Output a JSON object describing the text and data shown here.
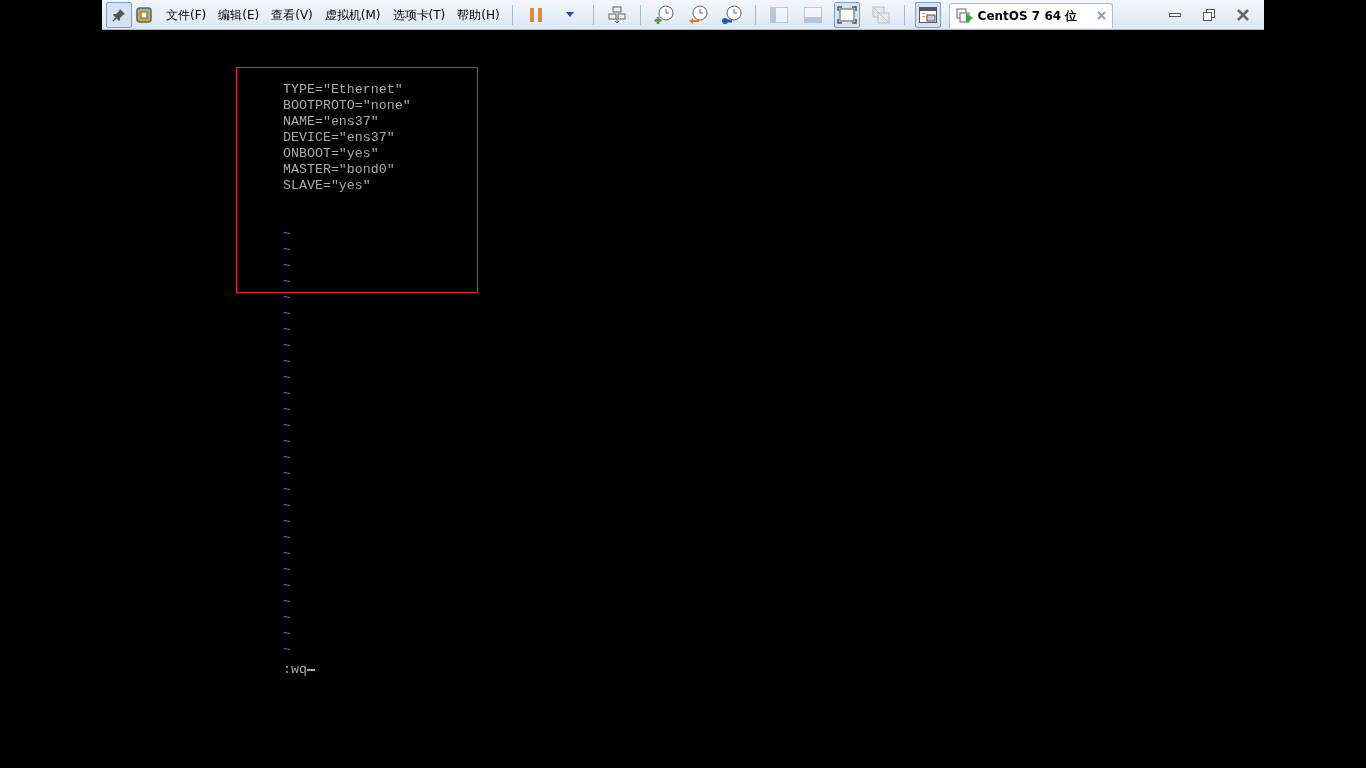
{
  "toolbar": {
    "menus": [
      "文件(F)",
      "编辑(E)",
      "查看(V)",
      "虚拟机(M)",
      "选项卡(T)",
      "帮助(H)"
    ],
    "buttons": [
      {
        "kind": "pause",
        "disabled": false,
        "pressed": false
      },
      {
        "kind": "dropdown",
        "disabled": false,
        "pressed": false
      },
      {
        "kind": "sep"
      },
      {
        "kind": "network",
        "disabled": false,
        "pressed": false
      },
      {
        "kind": "sep"
      },
      {
        "kind": "snapshot-take",
        "disabled": false,
        "pressed": false
      },
      {
        "kind": "snapshot-revert",
        "disabled": false,
        "pressed": false
      },
      {
        "kind": "snapshot-manage",
        "disabled": false,
        "pressed": false
      },
      {
        "kind": "sep"
      },
      {
        "kind": "view-sidebar",
        "disabled": true,
        "pressed": false
      },
      {
        "kind": "view-bottom",
        "disabled": true,
        "pressed": false
      },
      {
        "kind": "fullscreen",
        "disabled": false,
        "pressed": true
      },
      {
        "kind": "unity",
        "disabled": true,
        "pressed": false
      },
      {
        "kind": "sep"
      },
      {
        "kind": "library",
        "disabled": false,
        "pressed": true
      }
    ],
    "pin_pressed": true,
    "tab": {
      "title": "CentOS 7 64 位",
      "selected": true
    }
  },
  "terminal": {
    "lines": [
      {
        "kind": "text",
        "text": "TYPE=\"Ethernet\""
      },
      {
        "kind": "text",
        "text": "BOOTPROTO=\"none\""
      },
      {
        "kind": "text",
        "text": "NAME=\"ens37\""
      },
      {
        "kind": "text",
        "text": "DEVICE=\"ens37\""
      },
      {
        "kind": "text",
        "text": "ONBOOT=\"yes\""
      },
      {
        "kind": "text",
        "text": "MASTER=\"bond0\""
      },
      {
        "kind": "text",
        "text": "SLAVE=\"yes\""
      },
      {
        "kind": "blank"
      },
      {
        "kind": "blank"
      },
      {
        "kind": "tilde",
        "text": "~"
      },
      {
        "kind": "tilde",
        "text": "~"
      },
      {
        "kind": "tilde",
        "text": "~"
      },
      {
        "kind": "tilde",
        "text": "~"
      },
      {
        "kind": "tilde",
        "text": "~"
      },
      {
        "kind": "tilde",
        "text": "~"
      },
      {
        "kind": "tilde",
        "text": "~"
      },
      {
        "kind": "tilde",
        "text": "~"
      },
      {
        "kind": "tilde",
        "text": "~"
      },
      {
        "kind": "tilde",
        "text": "~"
      },
      {
        "kind": "tilde",
        "text": "~"
      },
      {
        "kind": "tilde",
        "text": "~"
      },
      {
        "kind": "tilde",
        "text": "~"
      },
      {
        "kind": "tilde",
        "text": "~"
      },
      {
        "kind": "tilde",
        "text": "~"
      },
      {
        "kind": "tilde",
        "text": "~"
      },
      {
        "kind": "tilde",
        "text": "~"
      },
      {
        "kind": "tilde",
        "text": "~"
      },
      {
        "kind": "tilde",
        "text": "~"
      },
      {
        "kind": "tilde",
        "text": "~"
      },
      {
        "kind": "tilde",
        "text": "~"
      },
      {
        "kind": "tilde",
        "text": "~"
      },
      {
        "kind": "tilde",
        "text": "~"
      },
      {
        "kind": "tilde",
        "text": "~"
      },
      {
        "kind": "tilde",
        "text": "~"
      },
      {
        "kind": "tilde",
        "text": "~"
      },
      {
        "kind": "tilde",
        "text": "~"
      }
    ],
    "command": ":wq",
    "cursor": true
  }
}
